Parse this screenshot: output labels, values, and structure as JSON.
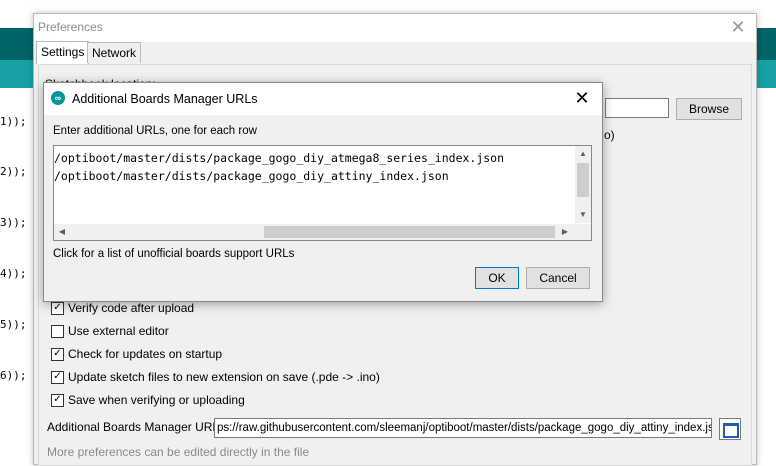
{
  "background_code": {
    "lines": [
      "1));",
      "2));",
      "3));",
      "4));",
      "5));",
      "6));"
    ]
  },
  "preferences": {
    "title": "Preferences",
    "tabs": [
      {
        "label": "Settings",
        "active": true
      },
      {
        "label": "Network",
        "active": false
      }
    ],
    "sketchbook_label": "Sketchbook location:",
    "browse_label": "Browse",
    "partial_paren": "o)",
    "checkboxes": [
      {
        "label": "Verify code after upload",
        "checked": true
      },
      {
        "label": "Use external editor",
        "checked": false
      },
      {
        "label": "Check for updates on startup",
        "checked": true
      },
      {
        "label": "Update sketch files to new extension on save (.pde -> .ino)",
        "checked": true
      },
      {
        "label": "Save when verifying or uploading",
        "checked": true
      }
    ],
    "boards_urls_label": "Additional Boards Manager URLs:",
    "boards_urls_value": "ps://raw.githubusercontent.com/sleemanj/optiboot/master/dists/package_gogo_diy_attiny_index.json",
    "more_prefs_text": "More preferences can be edited directly in the file"
  },
  "dialog": {
    "title": "Additional Boards Manager URLs",
    "instruction": "Enter additional URLs, one for each row",
    "urls": [
      "/optiboot/master/dists/package_gogo_diy_atmega8_series_index.json",
      "/optiboot/master/dists/package_gogo_diy_attiny_index.json"
    ],
    "link_text": "Click for a list of unofficial boards support URLs",
    "ok_label": "OK",
    "cancel_label": "Cancel"
  },
  "colors": {
    "teal_dark": "#006468",
    "teal_light": "#17a1a5",
    "focus_blue": "#0078d7"
  }
}
